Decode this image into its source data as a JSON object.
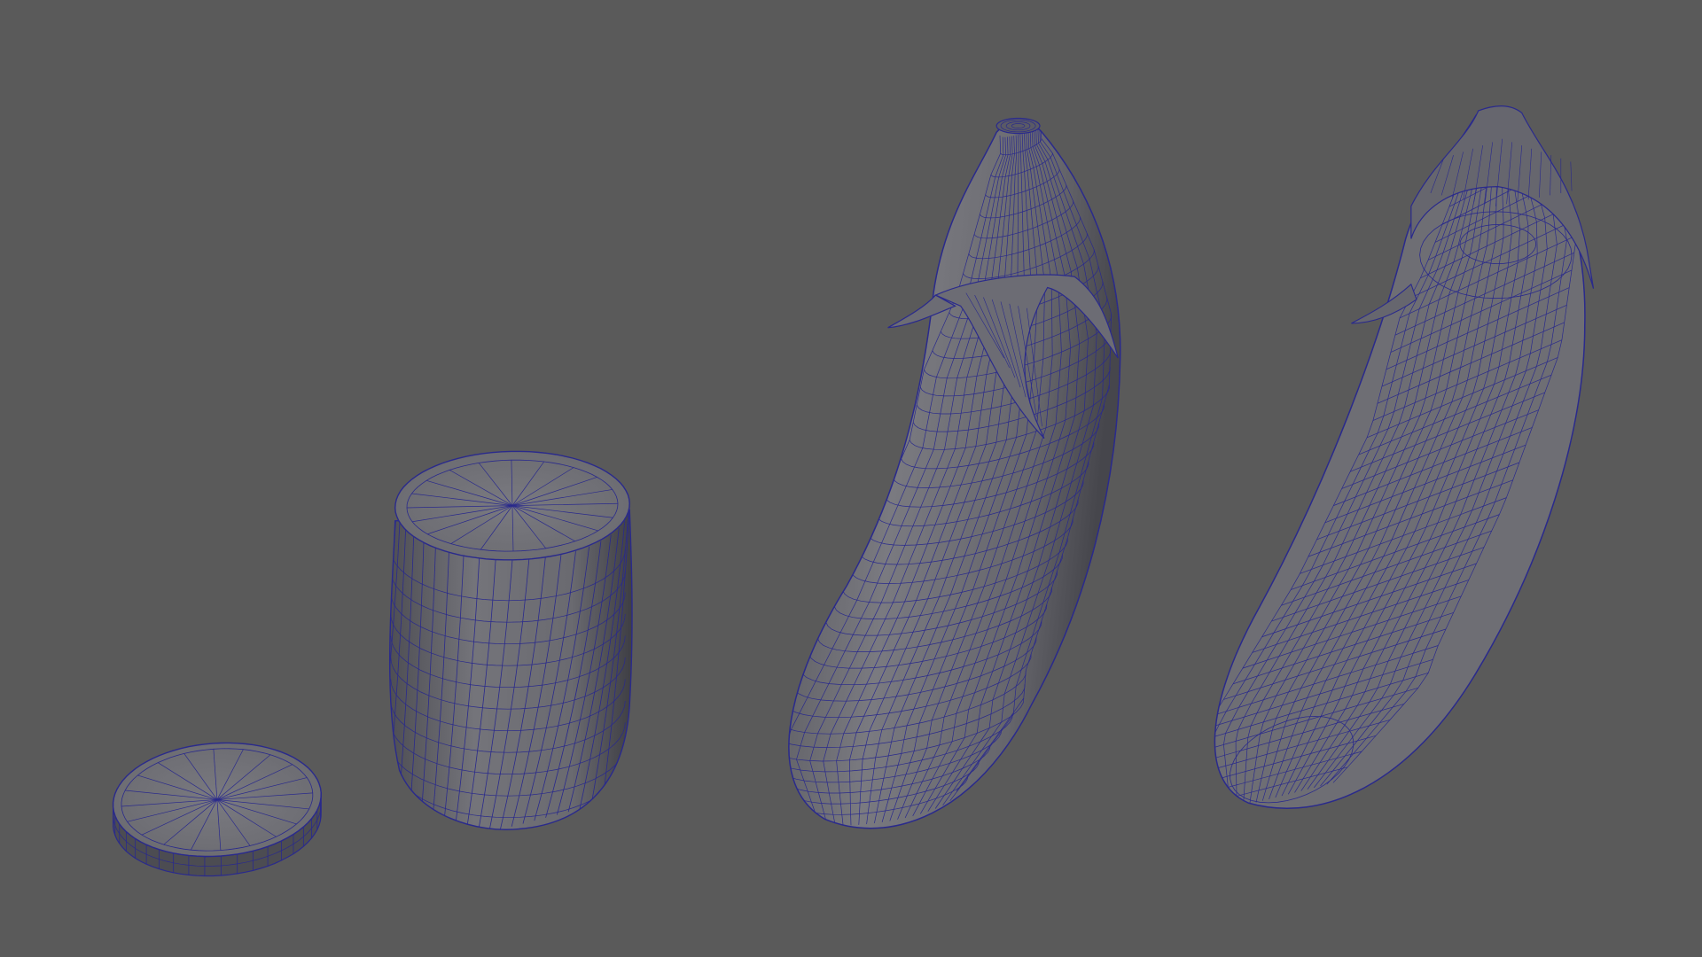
{
  "viewport": {
    "background": "#5a5a5a",
    "wire_color": "#2a2a8c",
    "surface_light": "#7e7e84",
    "surface_mid": "#6a6a70",
    "surface_dark": "#4a4a50"
  },
  "objects": [
    {
      "name": "eggplant-slice",
      "type": "mesh"
    },
    {
      "name": "eggplant-cut-section",
      "type": "mesh"
    },
    {
      "name": "eggplant-whole",
      "type": "mesh"
    },
    {
      "name": "eggplant-half",
      "type": "mesh"
    }
  ]
}
